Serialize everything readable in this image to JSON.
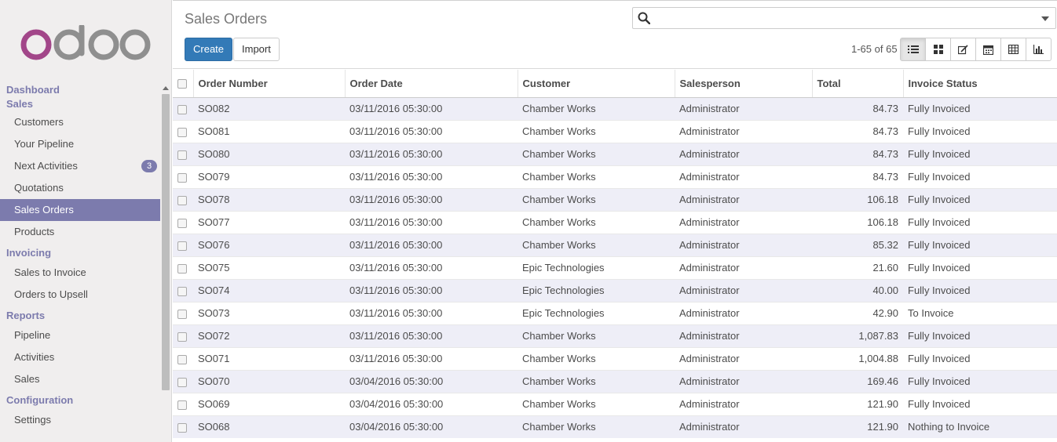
{
  "app": {
    "title": "Sales Orders"
  },
  "brand": {
    "accent": "#7c7bad",
    "primary": "#337ab7"
  },
  "sidebar": {
    "sections": [
      {
        "label": "Dashboard",
        "items": []
      },
      {
        "label": "Sales",
        "items": [
          {
            "label": "Customers",
            "active": false
          },
          {
            "label": "Your Pipeline",
            "active": false
          },
          {
            "label": "Next Activities",
            "active": false,
            "badge": "3"
          },
          {
            "label": "Quotations",
            "active": false
          },
          {
            "label": "Sales Orders",
            "active": true
          },
          {
            "label": "Products",
            "active": false
          }
        ]
      },
      {
        "label": "Invoicing",
        "items": [
          {
            "label": "Sales to Invoice",
            "active": false
          },
          {
            "label": "Orders to Upsell",
            "active": false
          }
        ]
      },
      {
        "label": "Reports",
        "items": [
          {
            "label": "Pipeline",
            "active": false
          },
          {
            "label": "Activities",
            "active": false
          },
          {
            "label": "Sales",
            "active": false
          }
        ]
      },
      {
        "label": "Configuration",
        "items": [
          {
            "label": "Settings",
            "active": false
          }
        ]
      }
    ]
  },
  "toolbar": {
    "create_label": "Create",
    "import_label": "Import"
  },
  "search": {
    "placeholder": ""
  },
  "pager": {
    "text": "1-65 of 65"
  },
  "views": [
    {
      "name": "list-view-icon",
      "active": true
    },
    {
      "name": "kanban-view-icon",
      "active": false
    },
    {
      "name": "form-view-icon",
      "active": false
    },
    {
      "name": "calendar-view-icon",
      "active": false
    },
    {
      "name": "pivot-view-icon",
      "active": false
    },
    {
      "name": "graph-view-icon",
      "active": false
    }
  ],
  "table": {
    "columns": [
      "Order Number",
      "Order Date",
      "Customer",
      "Salesperson",
      "Total",
      "Invoice Status"
    ],
    "rows": [
      [
        "SO082",
        "03/11/2016 05:30:00",
        "Chamber Works",
        "Administrator",
        "84.73",
        "Fully Invoiced"
      ],
      [
        "SO081",
        "03/11/2016 05:30:00",
        "Chamber Works",
        "Administrator",
        "84.73",
        "Fully Invoiced"
      ],
      [
        "SO080",
        "03/11/2016 05:30:00",
        "Chamber Works",
        "Administrator",
        "84.73",
        "Fully Invoiced"
      ],
      [
        "SO079",
        "03/11/2016 05:30:00",
        "Chamber Works",
        "Administrator",
        "84.73",
        "Fully Invoiced"
      ],
      [
        "SO078",
        "03/11/2016 05:30:00",
        "Chamber Works",
        "Administrator",
        "106.18",
        "Fully Invoiced"
      ],
      [
        "SO077",
        "03/11/2016 05:30:00",
        "Chamber Works",
        "Administrator",
        "106.18",
        "Fully Invoiced"
      ],
      [
        "SO076",
        "03/11/2016 05:30:00",
        "Chamber Works",
        "Administrator",
        "85.32",
        "Fully Invoiced"
      ],
      [
        "SO075",
        "03/11/2016 05:30:00",
        "Epic Technologies",
        "Administrator",
        "21.60",
        "Fully Invoiced"
      ],
      [
        "SO074",
        "03/11/2016 05:30:00",
        "Epic Technologies",
        "Administrator",
        "40.00",
        "Fully Invoiced"
      ],
      [
        "SO073",
        "03/11/2016 05:30:00",
        "Epic Technologies",
        "Administrator",
        "42.90",
        "To Invoice"
      ],
      [
        "SO072",
        "03/11/2016 05:30:00",
        "Chamber Works",
        "Administrator",
        "1,087.83",
        "Fully Invoiced"
      ],
      [
        "SO071",
        "03/11/2016 05:30:00",
        "Chamber Works",
        "Administrator",
        "1,004.88",
        "Fully Invoiced"
      ],
      [
        "SO070",
        "03/04/2016 05:30:00",
        "Chamber Works",
        "Administrator",
        "169.46",
        "Fully Invoiced"
      ],
      [
        "SO069",
        "03/04/2016 05:30:00",
        "Chamber Works",
        "Administrator",
        "121.90",
        "Fully Invoiced"
      ],
      [
        "SO068",
        "03/04/2016 05:30:00",
        "Chamber Works",
        "Administrator",
        "121.90",
        "Nothing to Invoice"
      ]
    ]
  }
}
